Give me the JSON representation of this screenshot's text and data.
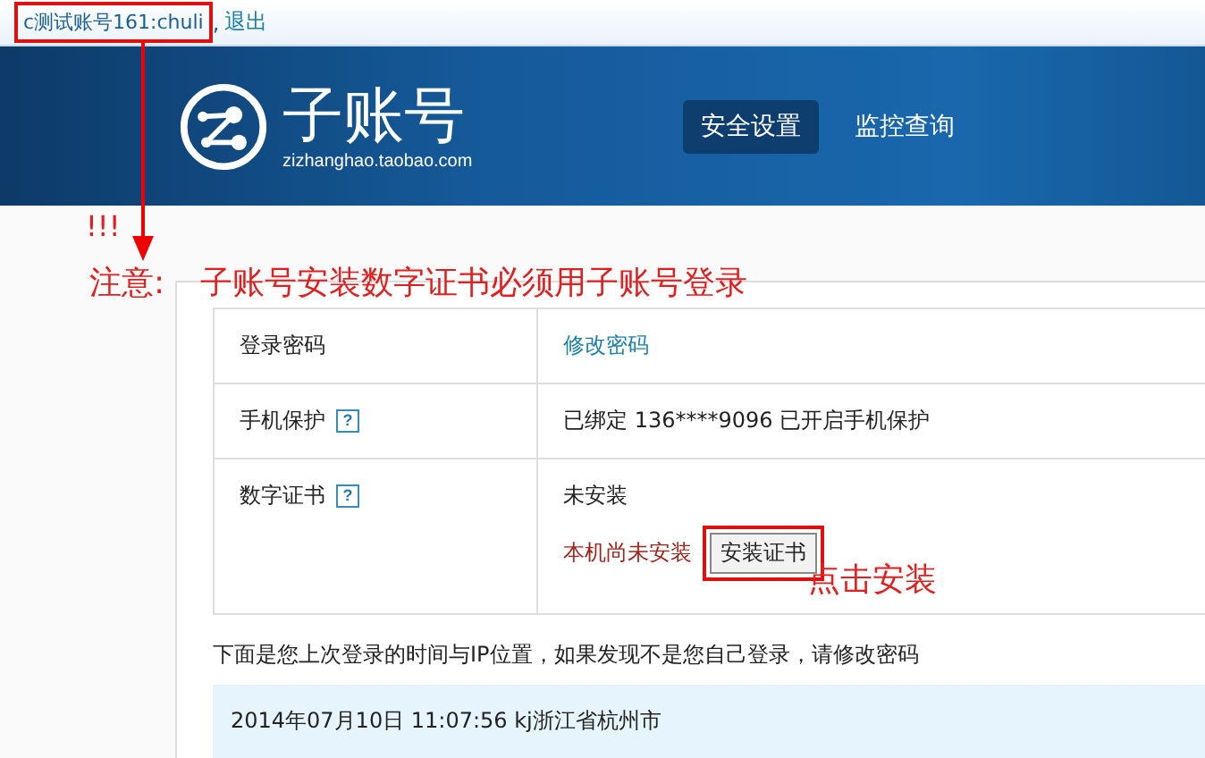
{
  "top_bar": {
    "user": "c测试账号161:chuli",
    "separator": ",",
    "logout": "退出"
  },
  "header": {
    "title": "子账号",
    "url": "zizhanghao.taobao.com",
    "nav": [
      {
        "label": "安全设置",
        "selected": true
      },
      {
        "label": "监控查询",
        "selected": false
      }
    ]
  },
  "annotations": {
    "marks": "!!!",
    "notice_label": "注意:",
    "notice": "子账号安装数字证书必须用子账号登录",
    "click_hint": "点击安装"
  },
  "security_table": [
    {
      "label": "登录密码",
      "help": false,
      "items": [
        {
          "kind": "link",
          "text": "修改密码"
        }
      ]
    },
    {
      "label": "手机保护",
      "help": true,
      "help_text": "?",
      "items": [
        {
          "kind": "text",
          "text": "已绑定 136****9096 已开启手机保护"
        }
      ]
    },
    {
      "label": "数字证书",
      "help": true,
      "help_text": "?",
      "items": [
        {
          "kind": "text",
          "text": "未安装"
        },
        {
          "kind": "warning",
          "text": "本机尚未安装",
          "button": "安装证书"
        }
      ]
    }
  ],
  "login_note": "下面是您上次登录的时间与IP位置，如果发现不是您自己登录，请修改密码",
  "last_login": "2014年07月10日 11:07:56 kj浙江省杭州市"
}
